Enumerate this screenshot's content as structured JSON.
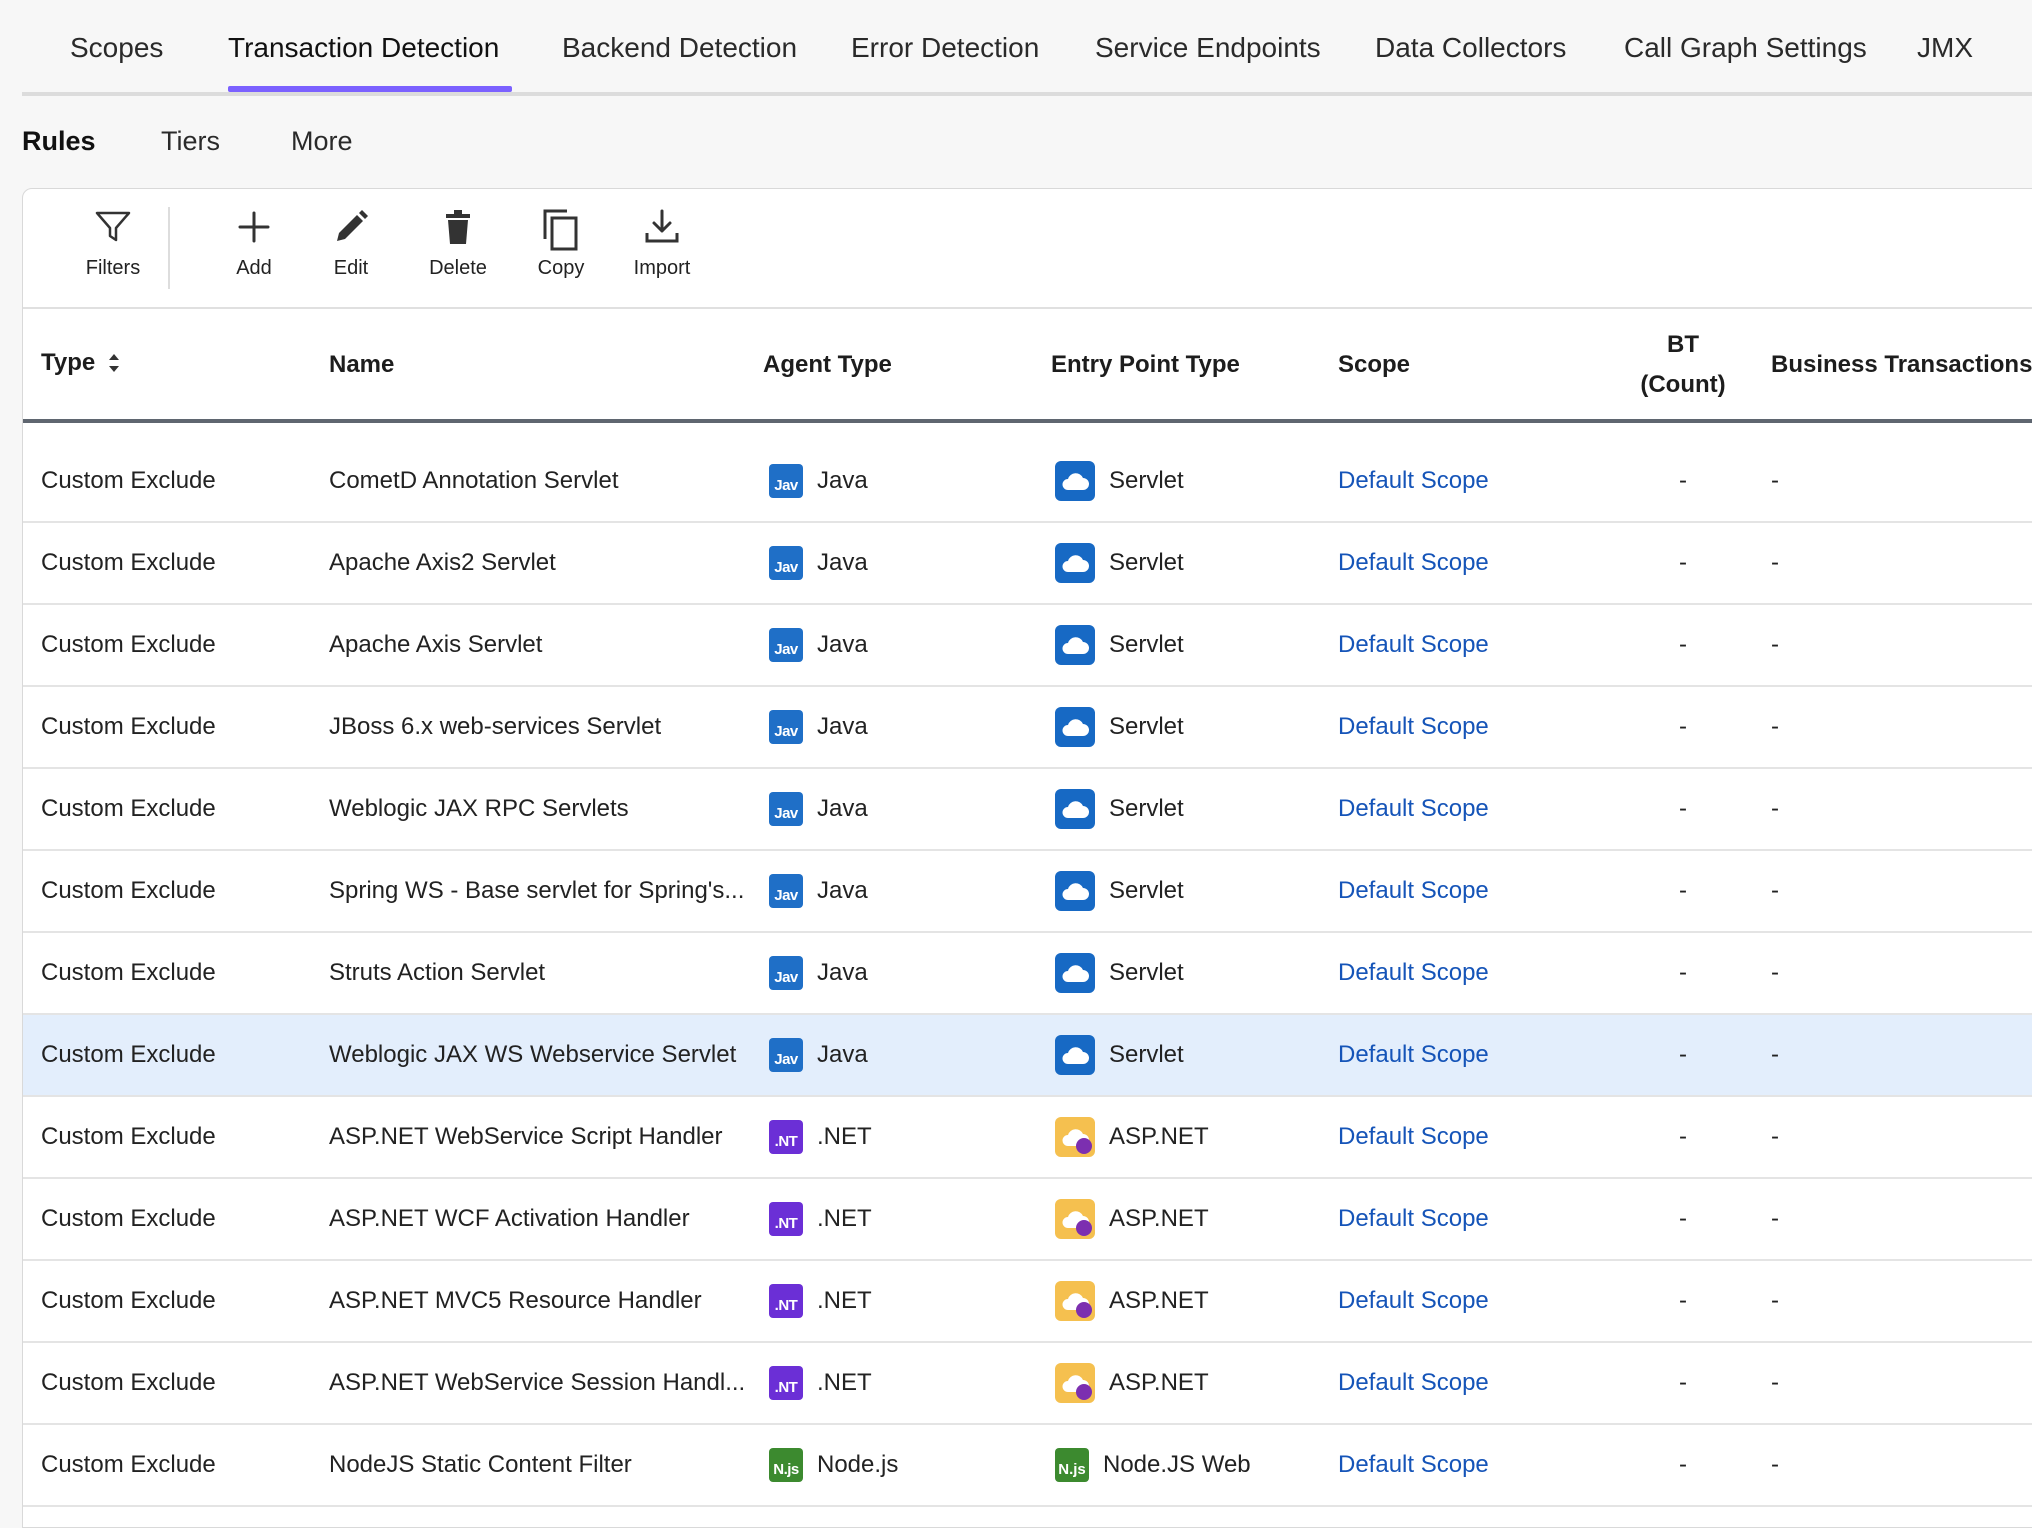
{
  "top_tabs": [
    "Scopes",
    "Transaction Detection",
    "Backend Detection",
    "Error Detection",
    "Service Endpoints",
    "Data Collectors",
    "Call Graph Settings",
    "JMX"
  ],
  "active_top_tab": "Transaction Detection",
  "sub_tabs": [
    "Rules",
    "Tiers",
    "More"
  ],
  "active_sub_tab": "Rules",
  "toolbar": {
    "filters": "Filters",
    "add": "Add",
    "edit": "Edit",
    "delete": "Delete",
    "copy": "Copy",
    "import": "Import"
  },
  "columns": {
    "type": "Type",
    "name": "Name",
    "agent_type": "Agent Type",
    "entry_point_type": "Entry Point Type",
    "scope": "Scope",
    "bt_line1": "BT",
    "bt_line2": "(Count)",
    "business_transactions": "Business Transactions"
  },
  "rows": [
    {
      "type": "Custom Exclude",
      "name": "CometD Annotation Servlet",
      "agent_badge": "Jav",
      "agent": "Java",
      "entry_badge": "",
      "entry": "Servlet",
      "scope": "Default Scope",
      "bt": "-",
      "bts": "-",
      "icon": "java"
    },
    {
      "type": "Custom Exclude",
      "name": "Apache Axis2 Servlet",
      "agent_badge": "Jav",
      "agent": "Java",
      "entry_badge": "",
      "entry": "Servlet",
      "scope": "Default Scope",
      "bt": "-",
      "bts": "-",
      "icon": "java"
    },
    {
      "type": "Custom Exclude",
      "name": "Apache Axis Servlet",
      "agent_badge": "Jav",
      "agent": "Java",
      "entry_badge": "",
      "entry": "Servlet",
      "scope": "Default Scope",
      "bt": "-",
      "bts": "-",
      "icon": "java"
    },
    {
      "type": "Custom Exclude",
      "name": "JBoss 6.x web-services Servlet",
      "agent_badge": "Jav",
      "agent": "Java",
      "entry_badge": "",
      "entry": "Servlet",
      "scope": "Default Scope",
      "bt": "-",
      "bts": "-",
      "icon": "java"
    },
    {
      "type": "Custom Exclude",
      "name": "Weblogic JAX RPC Servlets",
      "agent_badge": "Jav",
      "agent": "Java",
      "entry_badge": "",
      "entry": "Servlet",
      "scope": "Default Scope",
      "bt": "-",
      "bts": "-",
      "icon": "java"
    },
    {
      "type": "Custom Exclude",
      "name": "Spring WS - Base servlet for Spring's...",
      "agent_badge": "Jav",
      "agent": "Java",
      "entry_badge": "",
      "entry": "Servlet",
      "scope": "Default Scope",
      "bt": "-",
      "bts": "-",
      "icon": "java"
    },
    {
      "type": "Custom Exclude",
      "name": "Struts Action Servlet",
      "agent_badge": "Jav",
      "agent": "Java",
      "entry_badge": "",
      "entry": "Servlet",
      "scope": "Default Scope",
      "bt": "-",
      "bts": "-",
      "icon": "java"
    },
    {
      "type": "Custom Exclude",
      "name": "Weblogic JAX WS Webservice Servlet",
      "agent_badge": "Jav",
      "agent": "Java",
      "entry_badge": "",
      "entry": "Servlet",
      "scope": "Default Scope",
      "bt": "-",
      "bts": "-",
      "icon": "java",
      "highlight": true
    },
    {
      "type": "Custom Exclude",
      "name": "ASP.NET WebService Script Handler",
      "agent_badge": ".NT",
      "agent": ".NET",
      "entry_badge": "",
      "entry": "ASP.NET",
      "scope": "Default Scope",
      "bt": "-",
      "bts": "-",
      "icon": "net"
    },
    {
      "type": "Custom Exclude",
      "name": "ASP.NET WCF Activation Handler",
      "agent_badge": ".NT",
      "agent": ".NET",
      "entry_badge": "",
      "entry": "ASP.NET",
      "scope": "Default Scope",
      "bt": "-",
      "bts": "-",
      "icon": "net"
    },
    {
      "type": "Custom Exclude",
      "name": "ASP.NET MVC5 Resource Handler",
      "agent_badge": ".NT",
      "agent": ".NET",
      "entry_badge": "",
      "entry": "ASP.NET",
      "scope": "Default Scope",
      "bt": "-",
      "bts": "-",
      "icon": "net"
    },
    {
      "type": "Custom Exclude",
      "name": "ASP.NET WebService Session Handl...",
      "agent_badge": ".NT",
      "agent": ".NET",
      "entry_badge": "",
      "entry": "ASP.NET",
      "scope": "Default Scope",
      "bt": "-",
      "bts": "-",
      "icon": "net"
    },
    {
      "type": "Custom Exclude",
      "name": "NodeJS Static Content Filter",
      "agent_badge": "N.js",
      "agent": "Node.js",
      "entry_badge": "N.js",
      "entry": "Node.JS Web",
      "scope": "Default Scope",
      "bt": "-",
      "bts": "-",
      "icon": "node"
    }
  ],
  "colors": {
    "accent": "#7b61ff",
    "link": "#1554b8",
    "highlight_row": "#e3eefc"
  }
}
